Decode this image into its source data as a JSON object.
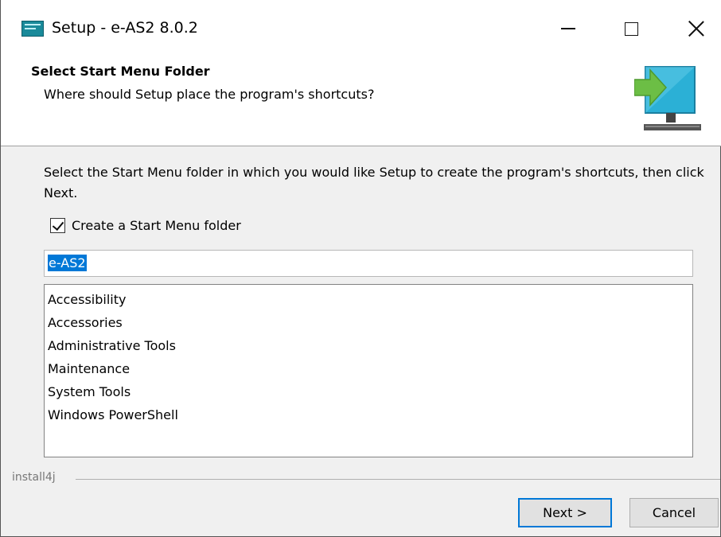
{
  "window": {
    "title": "Setup - e-AS2 8.0.2",
    "app_icon": "installer-app-icon",
    "controls": [
      "minimize-icon",
      "maximize-icon",
      "close-icon"
    ]
  },
  "header": {
    "title": "Select Start Menu Folder",
    "subtitle": "Where should Setup place the program's shortcuts?",
    "icon": "monitor-arrow-icon"
  },
  "content": {
    "description": "Select the Start Menu folder in which you would like Setup to create the program's shortcuts, then click Next.",
    "create_folder_label": "Create a Start Menu folder",
    "create_folder_checked": true,
    "folder_name_value": "e-AS2",
    "existing_folders": [
      "Accessibility",
      "Accessories",
      "Administrative Tools",
      "Maintenance",
      "System Tools",
      "Windows PowerShell"
    ]
  },
  "footer": {
    "brand": "install4j",
    "next_label": "Next >",
    "cancel_label": "Cancel"
  },
  "colors": {
    "selection": "#0078d7",
    "monitor_screen": "#2bb0d6",
    "arrow": "#6cbe45"
  }
}
